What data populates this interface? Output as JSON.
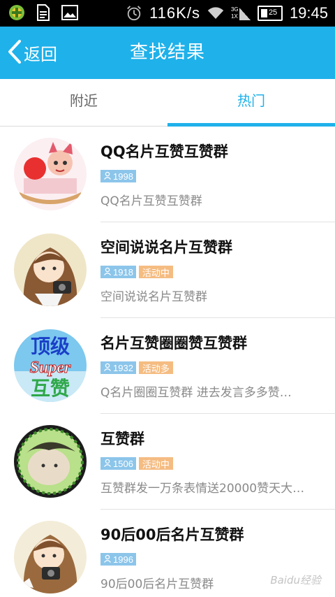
{
  "status_bar": {
    "speed": "116K/s",
    "network_top": "3G",
    "network_bottom": "1X",
    "battery": "25",
    "time": "19:45",
    "left_icons": [
      "app-icon",
      "document-icon",
      "image-icon"
    ],
    "right_icons": [
      "alarm-icon",
      "wifi-icon",
      "signal-icon",
      "battery-icon"
    ]
  },
  "header": {
    "back_label": "返回",
    "title": "查找结果"
  },
  "tabs": [
    {
      "label": "附近",
      "active": false
    },
    {
      "label": "热门",
      "active": true
    }
  ],
  "groups": [
    {
      "name": "QQ名片互赞互赞群",
      "members": "1998",
      "status": "",
      "description": "QQ名片互赞互赞群"
    },
    {
      "name": "空间说说名片互赞群",
      "members": "1918",
      "status": "活动中",
      "description": "空间说说名片互赞群"
    },
    {
      "name": "名片互赞圈圈赞互赞群",
      "members": "1932",
      "status": "活动多",
      "description": "Q名片圈圈互赞群 进去发言多多赞…"
    },
    {
      "name": "互赞群",
      "members": "1506",
      "status": "活动中",
      "description": "互赞群发一万条表情送20000赞天大…"
    },
    {
      "name": "90后00后名片互赞群",
      "members": "1996",
      "status": "",
      "description": "90后00后名片互赞群"
    }
  ],
  "avatar_text": {
    "top": "顶级",
    "middle": "Super",
    "bottom": "互赞"
  },
  "watermark": "Baidu经验",
  "colors": {
    "accent": "#1fb1ea",
    "member_badge": "#8cc5ea",
    "status_badge": "#f5bc82"
  }
}
